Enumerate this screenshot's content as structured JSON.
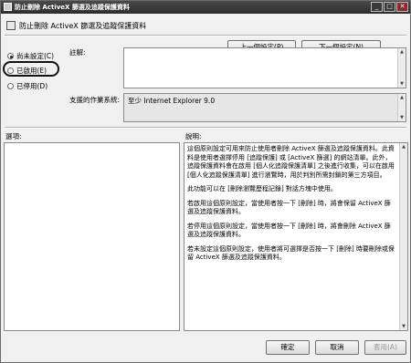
{
  "window": {
    "title": "防止刪除 ActiveX 篩選及追蹤保護資料",
    "controls": {
      "minimize": "_",
      "maximize": "□",
      "close": "✕"
    }
  },
  "header": {
    "policy_title": "防止刪除 ActiveX 篩選及追蹤保護資料",
    "prev_button": "上一個設定(P)",
    "next_button": "下一個設定(N)"
  },
  "radios": [
    {
      "label": "尚未設定(C)",
      "selected": true
    },
    {
      "label": "已啟用(E)",
      "selected": false
    },
    {
      "label": "已停用(D)",
      "selected": false
    }
  ],
  "comment": {
    "label": "註解:",
    "value": ""
  },
  "supported": {
    "label": "支援的作業系統:",
    "value": "至少 Internet Explorer 9.0"
  },
  "options": {
    "label": "選項:"
  },
  "help": {
    "label": "說明:",
    "paragraphs": [
      "這個原則設定可用來防止使用者刪除 ActiveX 篩選及追蹤保護資料。此資料是使用者選擇停用 [追蹤保護] 或 [ActiveX 篩選] 的網站清單。此外，追蹤保護資料會在啟用 [個人化追蹤保護清單] 之後進行收集，可以在啟用 [個人化追蹤保護清單] 進行瀏覽時，用於判別所需封鎖的第三方項目。",
      "此功能可以在 [刪除瀏覽歷程記錄] 對話方塊中使用。",
      "若啟用這個原則設定，當使用者按一下 [刪除] 時，將會保留 ActiveX 篩選及追蹤保護資料。",
      "若停用這個原則設定，當使用者按一下 [刪除] 時，將會刪除 ActiveX 篩選及追蹤保護資料。",
      "若未設定這個原則設定，使用者將可選擇是否按一下 [刪除] 時要刪除或保留 ActiveX 篩選及追蹤保護資料。"
    ]
  },
  "footer": {
    "ok": "確定",
    "cancel": "取消",
    "apply": "套用(A)"
  },
  "colors": {
    "titlebar": "#333333",
    "background": "#f0f0f0",
    "ring": "#111111"
  }
}
